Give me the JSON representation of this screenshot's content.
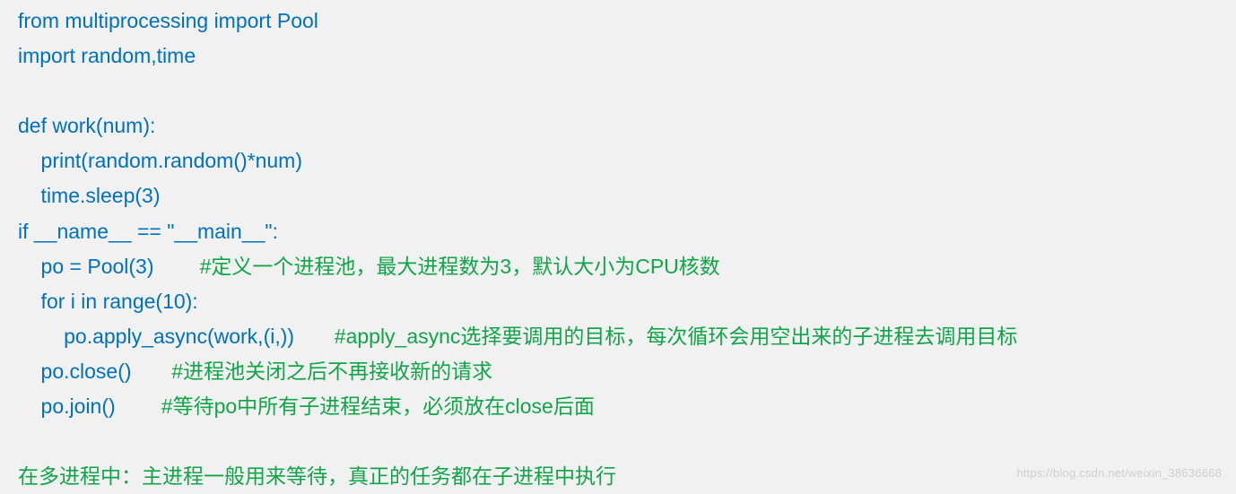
{
  "lines": {
    "l1": "from multiprocessing import Pool",
    "l2": "import random,time",
    "l3": "",
    "l4": "def work(num):",
    "l5": "    print(random.random()*num)",
    "l6": "    time.sleep(3)",
    "l7": "if __name__ == \"__main__\":",
    "l8_code": "    po = Pool(3)        ",
    "l8_comment": "#定义一个进程池，最大进程数为3，默认大小为CPU核数",
    "l9": "    for i in range(10):",
    "l10_code": "        po.apply_async(work,(i,))       ",
    "l10_comment": "#apply_async选择要调用的目标，每次循环会用空出来的子进程去调用目标",
    "l11_code": "    po.close()       ",
    "l11_comment": "#进程池关闭之后不再接收新的请求",
    "l12_code": "    po.join()        ",
    "l12_comment": "#等待po中所有子进程结束，必须放在close后面",
    "l13": "",
    "l14_comment": "在多进程中：主进程一般用来等待，真正的任务都在子进程中执行"
  },
  "watermark": "https://blog.csdn.net/weixin_38636668"
}
